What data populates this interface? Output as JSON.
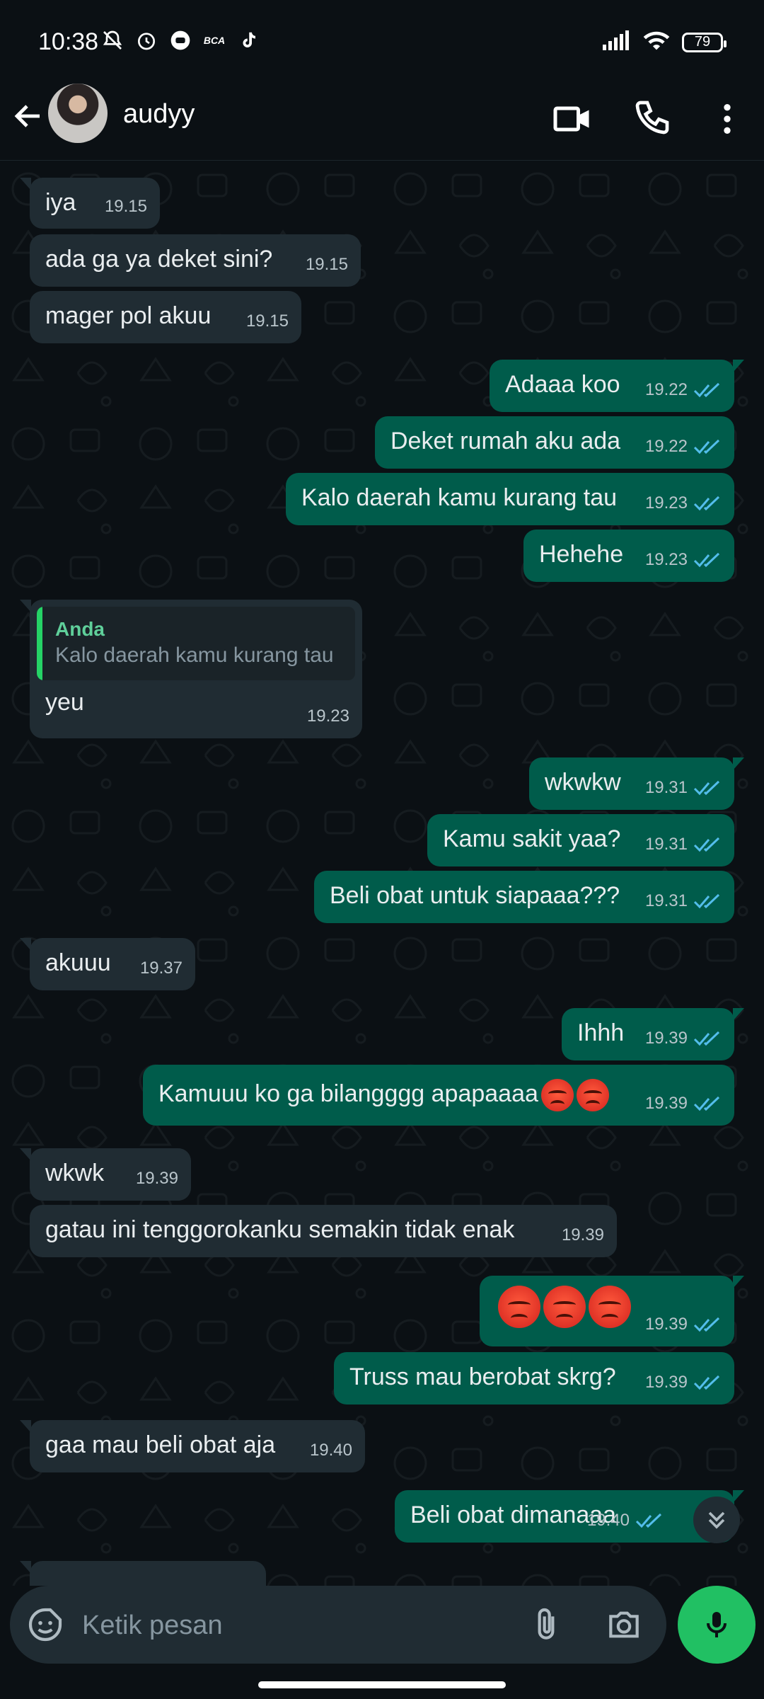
{
  "status_bar": {
    "time": "10:38",
    "battery": "79",
    "icons": [
      "mute-bell-icon",
      "alarm-icon",
      "music-icon",
      "bca-icon",
      "tiktok-icon"
    ]
  },
  "header": {
    "contact_name": "audyy"
  },
  "messages": [
    {
      "dir": "in",
      "text": "iya",
      "time": "19.15"
    },
    {
      "dir": "in",
      "text": "ada ga ya deket sini?",
      "time": "19.15"
    },
    {
      "dir": "in",
      "text": "mager pol akuu",
      "time": "19.15"
    },
    {
      "dir": "out",
      "text": "Adaaa koo",
      "time": "19.22"
    },
    {
      "dir": "out",
      "text": "Deket rumah aku ada",
      "time": "19.22"
    },
    {
      "dir": "out",
      "text": "Kalo daerah kamu kurang tau",
      "time": "19.23"
    },
    {
      "dir": "out",
      "text": "Hehehe",
      "time": "19.23"
    },
    {
      "dir": "in",
      "quote_name": "Anda",
      "quote_text": "Kalo daerah kamu kurang tau",
      "text": "yeu",
      "time": "19.23"
    },
    {
      "dir": "out",
      "text": "wkwkw",
      "time": "19.31"
    },
    {
      "dir": "out",
      "text": "Kamu sakit yaa?",
      "time": "19.31"
    },
    {
      "dir": "out",
      "text": "Beli obat untuk siapaaa???",
      "time": "19.31"
    },
    {
      "dir": "in",
      "text": "akuuu",
      "time": "19.37"
    },
    {
      "dir": "out",
      "text": "Ihhh",
      "time": "19.39"
    },
    {
      "dir": "out",
      "text": "Kamuuu ko ga bilangggg apapaaaa",
      "time": "19.39",
      "emoji_count": 2
    },
    {
      "dir": "in",
      "text": "wkwk",
      "time": "19.39"
    },
    {
      "dir": "in",
      "text": "gatau ini tenggorokanku semakin tidak enak",
      "time": "19.39"
    },
    {
      "dir": "out",
      "text": "",
      "time": "19.39",
      "emoji_count": 3
    },
    {
      "dir": "out",
      "text": "Truss mau berobat skrg?",
      "time": "19.39"
    },
    {
      "dir": "in",
      "text": "gaa mau beli obat aja",
      "time": "19.40"
    },
    {
      "dir": "out",
      "text": "Beli obat dimanaaa",
      "time": "19.40"
    }
  ],
  "composer": {
    "placeholder": "Ketik pesan"
  },
  "colors": {
    "incoming": "#202c33",
    "outgoing": "#005c4b",
    "read_ticks": "#53bdeb",
    "accent": "#21c063",
    "background": "#0b1014"
  }
}
